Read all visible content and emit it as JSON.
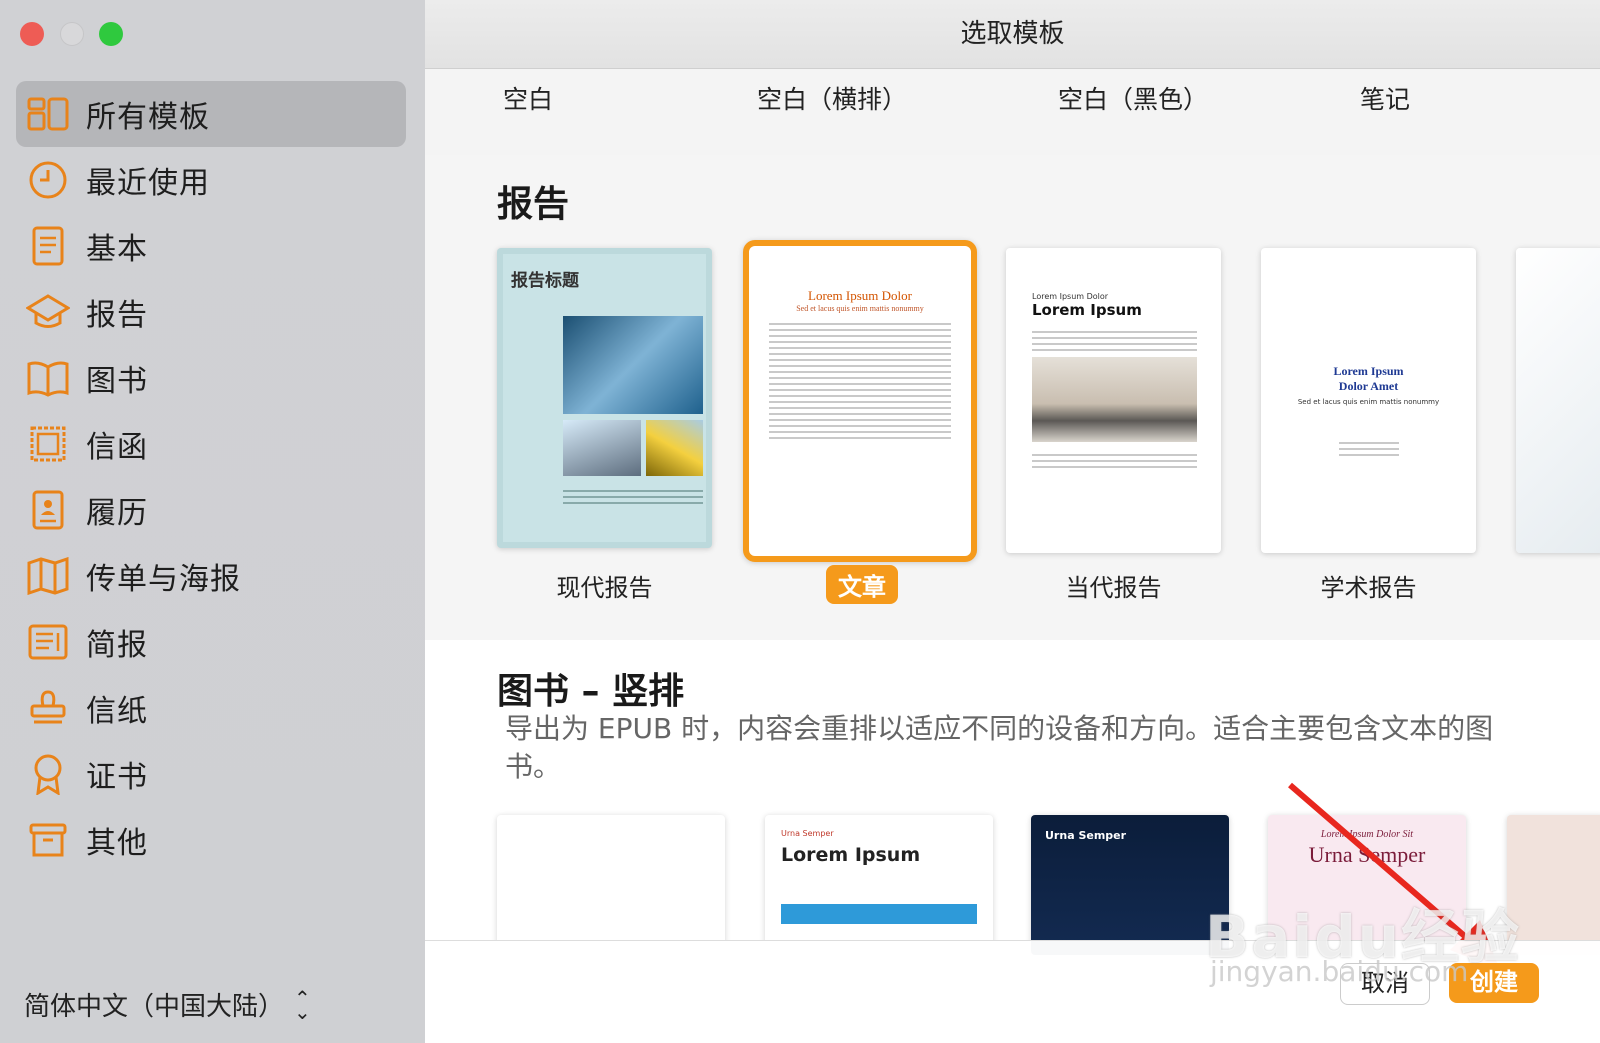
{
  "sidebar": {
    "items": [
      {
        "label": "所有模板",
        "icon": "grid-icon"
      },
      {
        "label": "最近使用",
        "icon": "clock-icon"
      },
      {
        "label": "基本",
        "icon": "document-icon"
      },
      {
        "label": "报告",
        "icon": "graduation-cap-icon"
      },
      {
        "label": "图书",
        "icon": "book-icon"
      },
      {
        "label": "信函",
        "icon": "stamp-frame-icon"
      },
      {
        "label": "履历",
        "icon": "resume-icon"
      },
      {
        "label": "传单与海报",
        "icon": "map-icon"
      },
      {
        "label": "简报",
        "icon": "newsletter-icon"
      },
      {
        "label": "信纸",
        "icon": "stamp-icon"
      },
      {
        "label": "证书",
        "icon": "ribbon-icon"
      },
      {
        "label": "其他",
        "icon": "archive-box-icon"
      }
    ],
    "language": "简体中文（中国大陆）"
  },
  "window": {
    "title": "选取模板"
  },
  "top_row": [
    "空白",
    "空白（横排）",
    "空白（黑色）",
    "笔记"
  ],
  "report_section": {
    "title": "报告",
    "templates": [
      {
        "label": "现代报告",
        "preview_title": "报告标题"
      },
      {
        "label": "文章",
        "preview_title": "Lorem Ipsum Dolor",
        "preview_subtitle": "Sed et lacus quis enim mattis nonummy"
      },
      {
        "label": "当代报告",
        "preview_title": "Lorem Ipsum",
        "preview_kicker": "Lorem Ipsum Dolor"
      },
      {
        "label": "学术报告",
        "preview_title": "Lorem Ipsum Dolor Amet",
        "preview_subtitle": "Sed et lacus quis enim mattis nonummy"
      }
    ]
  },
  "book_section": {
    "title": "图书 – 竖排",
    "description": "导出为 EPUB 时，内容会重排以适应不同的设备和方向。适合主要包含文本的图书。",
    "templates": [
      {
        "preview_title": ""
      },
      {
        "preview_kicker": "Urna Semper",
        "preview_title": "Lorem Ipsum"
      },
      {
        "preview_title": "Urna Semper"
      },
      {
        "preview_kicker": "Lorem Ipsum Dolor Sit",
        "preview_title": "Urna Semper"
      }
    ]
  },
  "buttons": {
    "cancel": "取消",
    "create": "创建"
  },
  "watermark": {
    "brand": "Baidu经验",
    "url": "jingyan.baidu.com"
  },
  "colors": {
    "accent": "#f59a1b",
    "sidebar_bg": "#cfd0d3",
    "annotation_arrow": "#e8271e"
  }
}
